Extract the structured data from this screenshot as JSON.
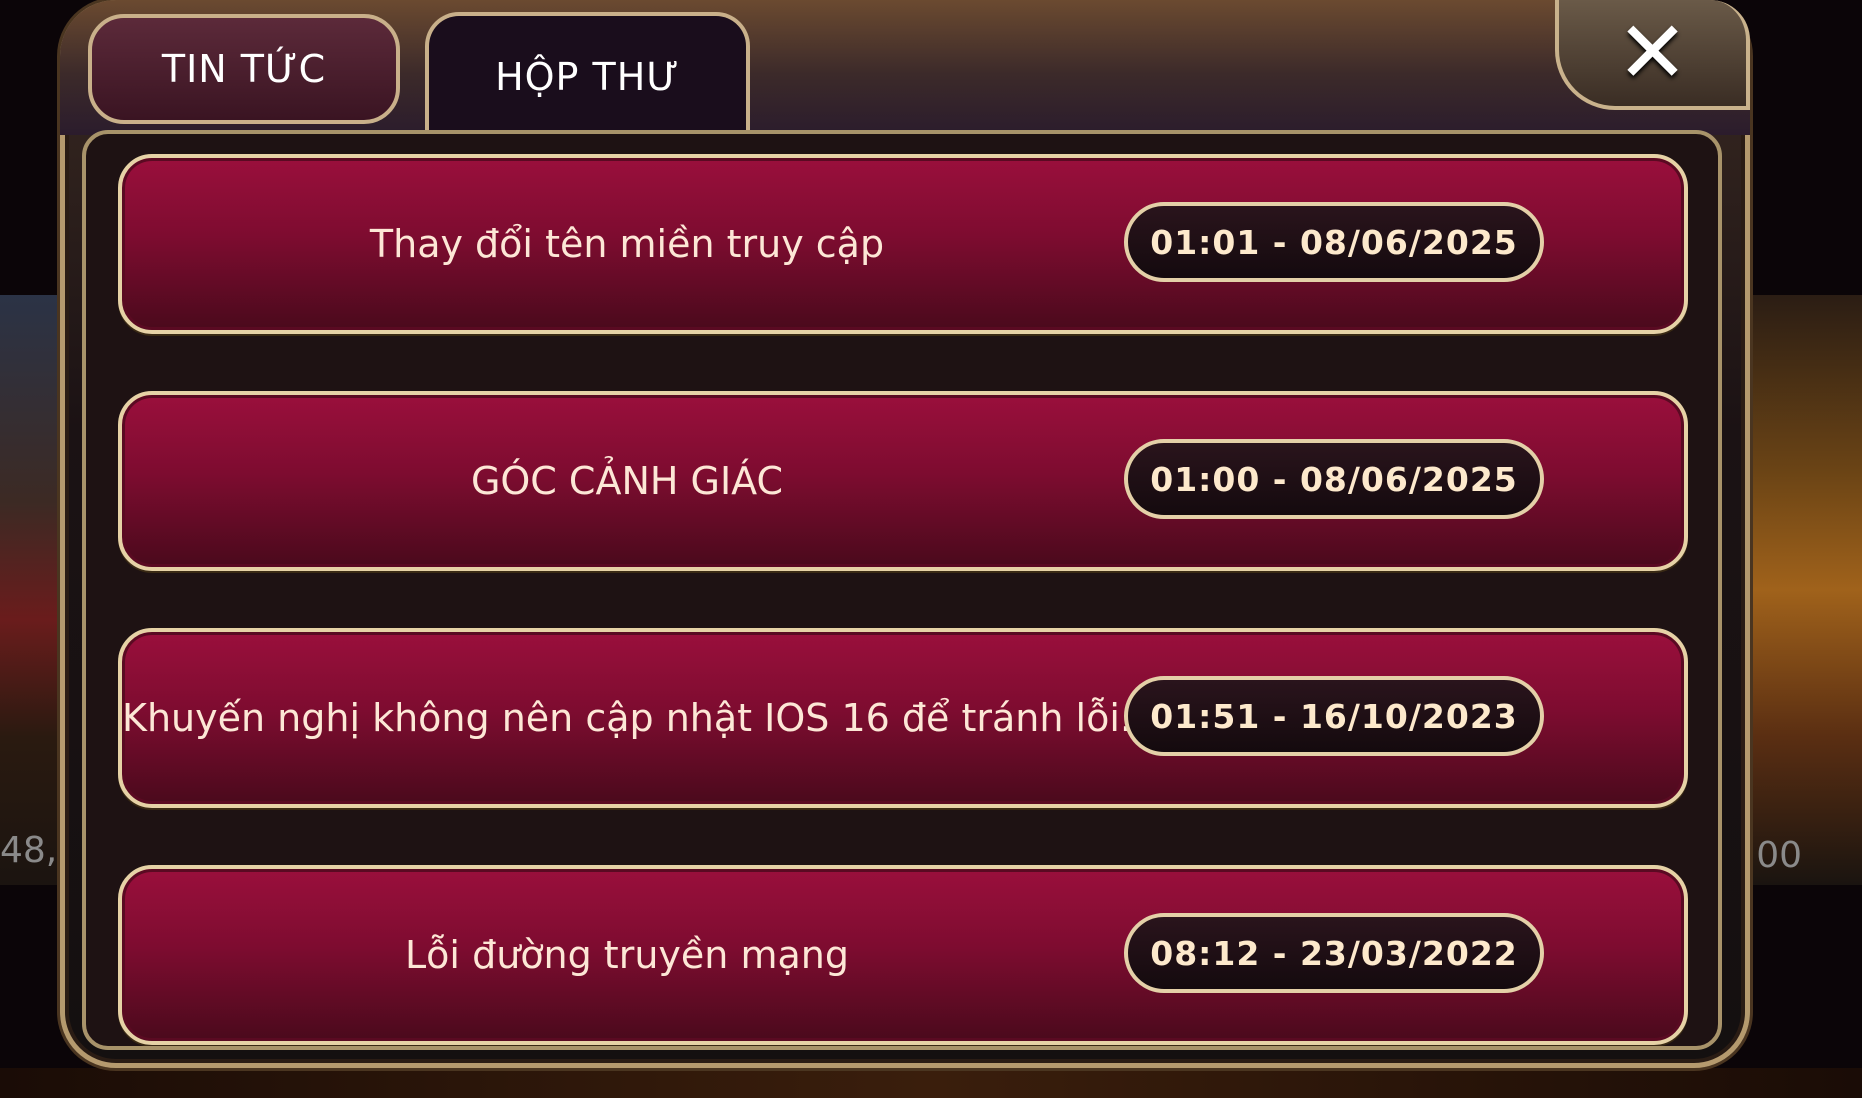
{
  "background": {
    "left_text": "48,",
    "right_text": "00"
  },
  "tabs": [
    {
      "label": "TIN TỨC",
      "active": false
    },
    {
      "label": "HỘP THƯ",
      "active": true
    }
  ],
  "close_icon": "close-icon",
  "messages": [
    {
      "title": "Thay đổi tên miền truy cập",
      "time": "01:01 - 08/06/2025"
    },
    {
      "title": "GÓC CẢNH GIÁC",
      "time": "01:00 - 08/06/2025"
    },
    {
      "title": "Khuyến nghị không nên cập nhật IOS 16 để tránh lỗi.",
      "time": "01:51 - 16/10/2023"
    },
    {
      "title": "Lỗi đường truyền mạng",
      "time": "08:12 - 23/03/2022"
    }
  ],
  "colors": {
    "row_red": "#9a0f3c",
    "border_gold": "#e6d2a6",
    "text_cream": "#fde7d6"
  }
}
